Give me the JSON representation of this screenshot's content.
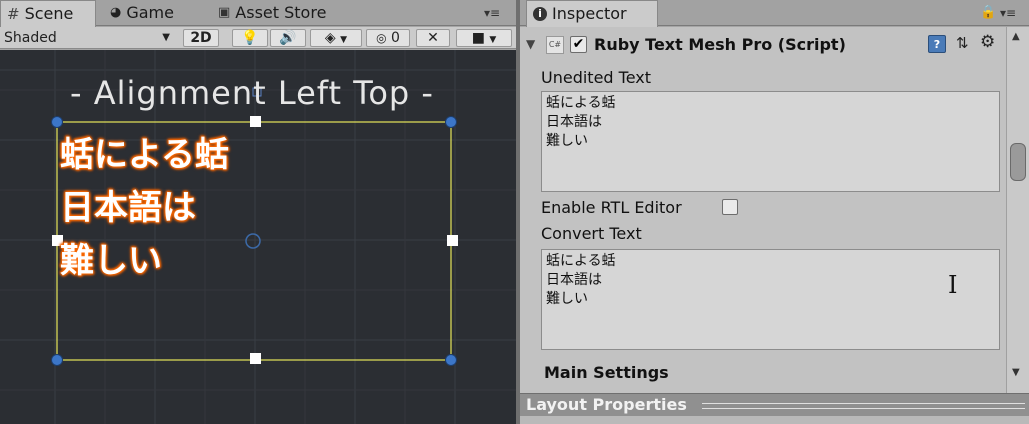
{
  "scene_panel": {
    "tabs": [
      {
        "label": "Scene",
        "icon": "grid-icon",
        "active": true
      },
      {
        "label": "Game",
        "icon": "pacman-icon",
        "active": false
      },
      {
        "label": "Asset Store",
        "icon": "shop-icon",
        "active": false
      }
    ],
    "toolbar": {
      "shading_mode": "Shaded",
      "mode_2d_label": "2D",
      "hidden_count": "0"
    },
    "scene_text": {
      "title": "- Alignment Left Top -",
      "line1": "蛞による蛞",
      "line2": "日本語は",
      "line3": "難しい"
    }
  },
  "inspector": {
    "tab_label": "Inspector",
    "component_name": "Ruby Text Mesh Pro (Script)",
    "script_badge": "C#",
    "unedited_text_label": "Unedited Text",
    "unedited_text_value": "蛞による蛞\n日本語は\n難しい",
    "enable_rtl_label": "Enable RTL Editor",
    "enable_rtl_checked": false,
    "convert_text_label": "Convert Text",
    "convert_text_value": "蛞による蛞\n日本語は\n難しい",
    "main_settings_label": "Main Settings",
    "layout_properties_label": "Layout Properties"
  },
  "colors": {
    "scene_background": "#2b2e33",
    "selection_rect": "#e6e65a",
    "handle_blue": "#3c76c8",
    "text_outline": "#ff6a00"
  }
}
